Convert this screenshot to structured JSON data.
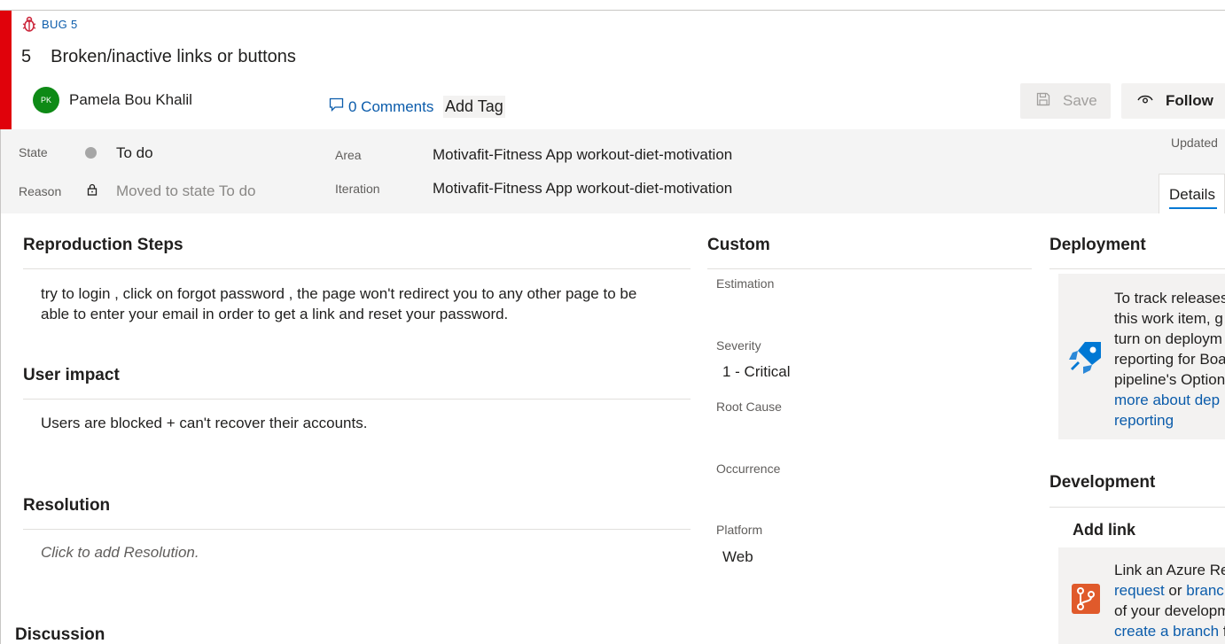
{
  "work_item": {
    "type_label": "BUG 5",
    "id": "5",
    "title": "Broken/inactive links or buttons"
  },
  "assignee": {
    "initials": "PK",
    "name": "Pamela Bou Khalil"
  },
  "header": {
    "comments_label": "0 Comments",
    "add_tag_label": "Add Tag",
    "save_label": "Save",
    "follow_label": "Follow",
    "updated_label": "Updated",
    "details_tab_label": "Details"
  },
  "fields": {
    "state_label": "State",
    "state_value": "To do",
    "reason_label": "Reason",
    "reason_value": "Moved to state To do",
    "area_label": "Area",
    "area_value": "Motivafit-Fitness App workout-diet-motivation",
    "iteration_label": "Iteration",
    "iteration_value": "Motivafit-Fitness App workout-diet-motivation"
  },
  "left": {
    "repro_title": "Reproduction Steps",
    "repro_line1": "try to login , click on forgot password , the page won't redirect you to any other page to be",
    "repro_line2": "able to enter your email in order to get a link and reset your password.",
    "impact_title": "User impact",
    "impact_text": "Users are  blocked + can't recover their accounts.",
    "resolution_title": "Resolution",
    "resolution_placeholder": "Click to add Resolution.",
    "discussion_title": "Discussion"
  },
  "custom": {
    "title": "Custom",
    "estimation_label": "Estimation",
    "severity_label": "Severity",
    "severity_value": "1 - Critical",
    "root_cause_label": "Root Cause",
    "occurrence_label": "Occurrence",
    "platform_label": "Platform",
    "platform_value": "Web"
  },
  "deployment": {
    "title": "Deployment",
    "line1": "To track releases",
    "line2": "this work item, g",
    "line3": "turn on deploym",
    "line4": "reporting for Boa",
    "line5": "pipeline's Option",
    "link1": "more about dep",
    "link2": "reporting"
  },
  "development": {
    "title": "Development",
    "add_link_label": "Add link",
    "line1": "Link an Azure Re",
    "link_request": "request",
    "or_text": " or ",
    "link_branch": "branc",
    "line3": "of your developm",
    "link_create_branch": "create a branch",
    "line4_tail": " f"
  },
  "colors": {
    "accent": "#0078d4",
    "bug_red": "#e0020b",
    "link": "#0b5cab",
    "avatar": "#0e8a16"
  },
  "icons": [
    "bug-icon",
    "comment-icon",
    "save-icon",
    "eye-icon",
    "lock-icon",
    "rocket-icon",
    "git-branch-icon"
  ]
}
